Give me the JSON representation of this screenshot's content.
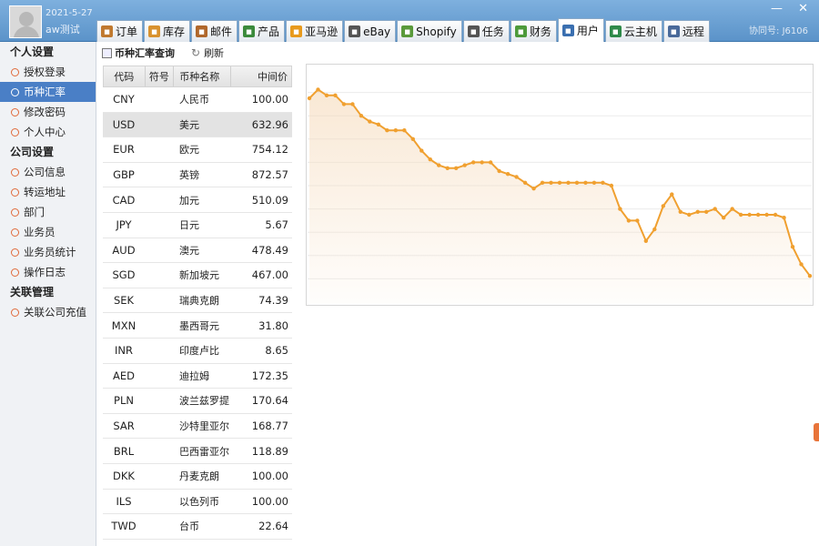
{
  "user": {
    "date": "2021-5-27",
    "name": "aw测试"
  },
  "tabs": [
    {
      "label": "订单",
      "icon": "order-icon",
      "color": "#c0792f"
    },
    {
      "label": "库存",
      "icon": "inventory-icon",
      "color": "#d9922e"
    },
    {
      "label": "邮件",
      "icon": "mail-icon",
      "color": "#b0672b"
    },
    {
      "label": "产品",
      "icon": "product-icon",
      "color": "#3b8a3b"
    },
    {
      "label": "亚马逊",
      "icon": "amazon-icon",
      "color": "#e89a1c"
    },
    {
      "label": "eBay",
      "icon": "ebay-icon",
      "color": "#555555"
    },
    {
      "label": "Shopify",
      "icon": "shopify-icon",
      "color": "#5a9a3a"
    },
    {
      "label": "任务",
      "icon": "task-icon",
      "color": "#555555"
    },
    {
      "label": "财务",
      "icon": "finance-icon",
      "color": "#4d9a3a"
    },
    {
      "label": "用户",
      "icon": "user-icon",
      "color": "#3a6fb0",
      "active": true
    },
    {
      "label": "云主机",
      "icon": "cloud-host-icon",
      "color": "#2f8a4a"
    },
    {
      "label": "远程",
      "icon": "remote-icon",
      "color": "#4a6a9a"
    }
  ],
  "window": {
    "id_label": "协同号: J6106",
    "minimize": "—",
    "restore": "✕"
  },
  "sidebar": {
    "sections": [
      {
        "title": "个人设置",
        "items": [
          {
            "label": "授权登录"
          },
          {
            "label": "币种汇率",
            "active": true
          },
          {
            "label": "修改密码"
          },
          {
            "label": "个人中心"
          }
        ]
      },
      {
        "title": "公司设置",
        "items": [
          {
            "label": "公司信息"
          },
          {
            "label": "转运地址"
          },
          {
            "label": "部门"
          },
          {
            "label": "业务员"
          },
          {
            "label": "业务员统计"
          },
          {
            "label": "操作日志"
          }
        ]
      },
      {
        "title": "关联管理",
        "items": [
          {
            "label": "关联公司充值"
          }
        ]
      }
    ]
  },
  "toolbar": {
    "title": "币种汇率查询",
    "refresh": "刷新"
  },
  "table": {
    "headers": [
      "代码",
      "符号",
      "币种名称",
      "中间价"
    ],
    "rows": [
      {
        "code": "CNY",
        "symbol": "",
        "name": "人民币",
        "rate": "100.00"
      },
      {
        "code": "USD",
        "symbol": "",
        "name": "美元",
        "rate": "632.96",
        "selected": true
      },
      {
        "code": "EUR",
        "symbol": "",
        "name": "欧元",
        "rate": "754.12"
      },
      {
        "code": "GBP",
        "symbol": "",
        "name": "英镑",
        "rate": "872.57"
      },
      {
        "code": "CAD",
        "symbol": "",
        "name": "加元",
        "rate": "510.09"
      },
      {
        "code": "JPY",
        "symbol": "",
        "name": "日元",
        "rate": "5.67"
      },
      {
        "code": "AUD",
        "symbol": "",
        "name": "澳元",
        "rate": "478.49"
      },
      {
        "code": "SGD",
        "symbol": "",
        "name": "新加坡元",
        "rate": "467.00"
      },
      {
        "code": "SEK",
        "symbol": "",
        "name": "瑞典克朗",
        "rate": "74.39"
      },
      {
        "code": "MXN",
        "symbol": "",
        "name": "墨西哥元",
        "rate": "31.80"
      },
      {
        "code": "INR",
        "symbol": "",
        "name": "印度卢比",
        "rate": "8.65"
      },
      {
        "code": "AED",
        "symbol": "",
        "name": "迪拉姆",
        "rate": "172.35"
      },
      {
        "code": "PLN",
        "symbol": "",
        "name": "波兰兹罗提",
        "rate": "170.64"
      },
      {
        "code": "SAR",
        "symbol": "",
        "name": "沙特里亚尔",
        "rate": "168.77"
      },
      {
        "code": "BRL",
        "symbol": "",
        "name": "巴西雷亚尔",
        "rate": "118.89"
      },
      {
        "code": "DKK",
        "symbol": "",
        "name": "丹麦克朗",
        "rate": "100.00"
      },
      {
        "code": "ILS",
        "symbol": "",
        "name": "以色列币",
        "rate": "100.00"
      },
      {
        "code": "TWD",
        "symbol": "",
        "name": "台币",
        "rate": "22.64"
      }
    ]
  },
  "chart_data": {
    "type": "area",
    "title": "",
    "line_color": "#f0a030",
    "grid": true,
    "values": [
      80,
      83,
      81,
      81,
      78,
      78,
      74,
      72,
      71,
      69,
      69,
      69,
      66,
      62,
      59,
      57,
      56,
      56,
      57,
      58,
      58,
      58,
      55,
      54,
      53,
      51,
      49,
      51,
      51,
      51,
      51,
      51,
      51,
      51,
      51,
      50,
      42,
      38,
      38,
      31,
      35,
      43,
      47,
      41,
      40,
      41,
      41,
      42,
      39,
      42,
      40,
      40,
      40,
      40,
      40,
      39,
      29,
      23,
      19
    ],
    "ylim": [
      10,
      90
    ]
  }
}
